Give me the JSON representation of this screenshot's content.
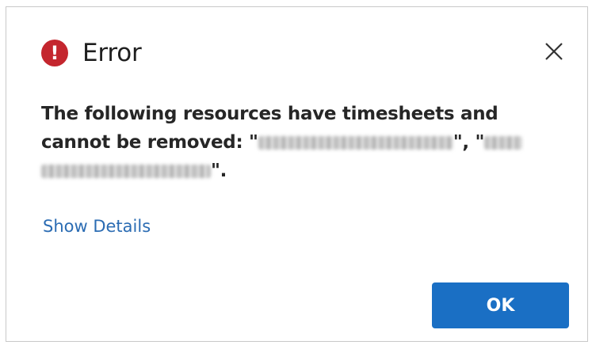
{
  "dialog": {
    "title": "Error",
    "icon": "error-icon",
    "close_icon": "close-icon",
    "message_part1": "The following resources have timesheets and cannot be removed: \"",
    "message_part2": "\", \"",
    "message_part3": "\".",
    "link_label": "Show Details",
    "ok_label": "OK"
  },
  "colors": {
    "error": "#c4262e",
    "link": "#2b6cb3",
    "primary_button": "#1a6fc4"
  }
}
